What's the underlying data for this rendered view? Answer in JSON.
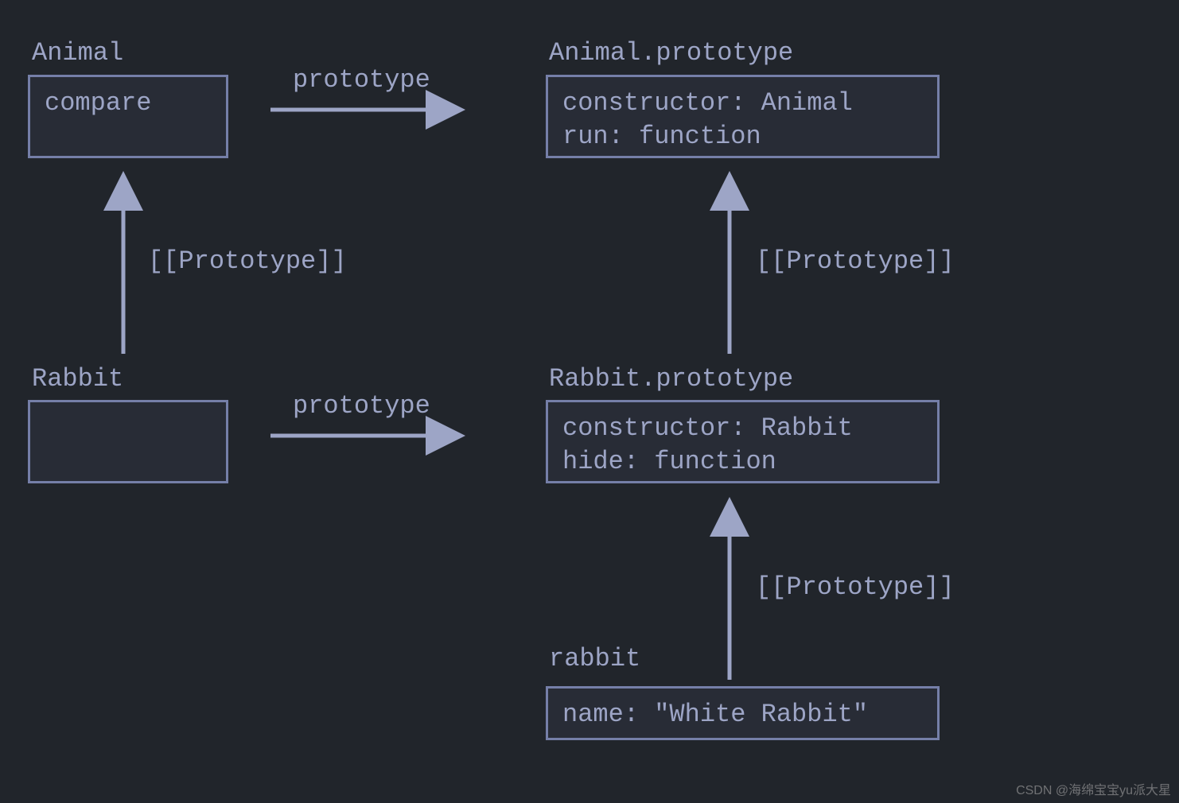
{
  "colors": {
    "background": "#21252b",
    "box_fill": "#282c36",
    "border": "#757fa8",
    "text": "#9da5c6",
    "arrow": "#9da5c6"
  },
  "boxes": {
    "animal_class": {
      "title": "Animal",
      "content": "compare"
    },
    "animal_prototype": {
      "title": "Animal.prototype",
      "line1": "constructor: Animal",
      "line2": "run: function"
    },
    "rabbit_class": {
      "title": "Rabbit",
      "content": ""
    },
    "rabbit_prototype": {
      "title": "Rabbit.prototype",
      "line1": "constructor: Rabbit",
      "line2": "hide: function"
    },
    "rabbit_instance": {
      "title": "rabbit",
      "content": "name: \"White Rabbit\""
    }
  },
  "arrows": {
    "animal_to_proto": "prototype",
    "rabbit_to_proto": "prototype",
    "rabbit_class_to_animal_class": "[[Prototype]]",
    "rabbit_proto_to_animal_proto": "[[Prototype]]",
    "rabbit_instance_to_rabbit_proto": "[[Prototype]]"
  },
  "watermark": "CSDN @海绵宝宝yu派大星"
}
